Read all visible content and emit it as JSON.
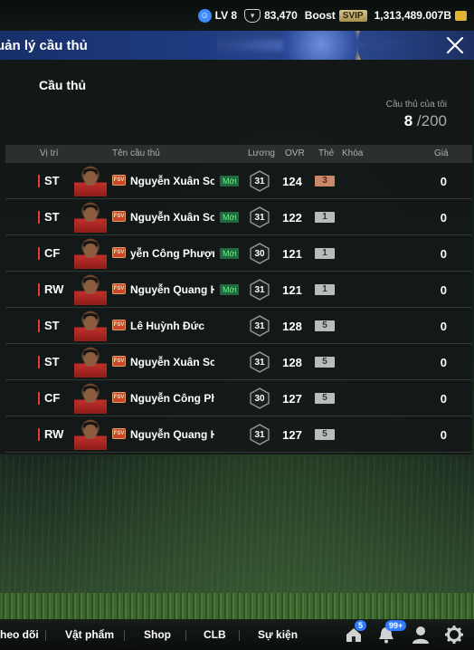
{
  "statusbar": {
    "level": "LV 8",
    "coins": "83,470",
    "boost_label": "Boost",
    "svip_label": "SVIP",
    "gold": "1,313,489.007B"
  },
  "header": {
    "title": "uản lý cầu thủ"
  },
  "panel": {
    "title": "Cầu thủ",
    "mycount_label": "Cầu thủ của tôi",
    "mycount_current": "8",
    "mycount_max": "/200"
  },
  "table": {
    "headers": {
      "position": "Vị trí",
      "name": "Tên cầu thủ",
      "salary": "Lương",
      "ovr": "OVR",
      "grade": "Thẻ",
      "lock": "Khóa",
      "price": "Giá"
    },
    "rows": [
      {
        "pos": "ST",
        "name": "Nguyễn Xuân Son",
        "new": "Mới",
        "salary": "31",
        "ovr": "124",
        "grade": "3",
        "price": "0"
      },
      {
        "pos": "ST",
        "name": "Nguyễn Xuân Son",
        "new": "Mới",
        "salary": "31",
        "ovr": "122",
        "grade": "1",
        "price": "0"
      },
      {
        "pos": "CF",
        "name": "yễn Công Phượng",
        "new": "Mới",
        "salary": "30",
        "ovr": "121",
        "grade": "1",
        "price": "0"
      },
      {
        "pos": "RW",
        "name": "Nguyễn Quang Hả",
        "new": "Mới",
        "salary": "31",
        "ovr": "121",
        "grade": "1",
        "price": "0"
      },
      {
        "pos": "ST",
        "name": "Lê Huỳnh Đức",
        "new": "",
        "salary": "31",
        "ovr": "128",
        "grade": "5",
        "price": "0"
      },
      {
        "pos": "ST",
        "name": "Nguyễn Xuân Son",
        "new": "",
        "salary": "31",
        "ovr": "128",
        "grade": "5",
        "price": "0"
      },
      {
        "pos": "CF",
        "name": "Nguyễn Công Phượng",
        "new": "",
        "salary": "30",
        "ovr": "127",
        "grade": "5",
        "price": "0"
      },
      {
        "pos": "RW",
        "name": "Nguyễn Quang Hải",
        "new": "",
        "salary": "31",
        "ovr": "127",
        "grade": "5",
        "price": "0"
      }
    ],
    "season_label": "FSV"
  },
  "bottomnav": {
    "items": [
      "heo dõi",
      "Vật phẩm",
      "Shop",
      "CLB",
      "Sự kiện"
    ],
    "home_badge": "5",
    "bell_badge": "99+"
  },
  "icons": {
    "level": "level-icon",
    "coin": "coin-icon",
    "gold": "gold-icon",
    "close": "close-icon",
    "home": "home-icon",
    "bell": "bell-icon",
    "profile": "profile-icon",
    "settings": "gear-icon"
  }
}
